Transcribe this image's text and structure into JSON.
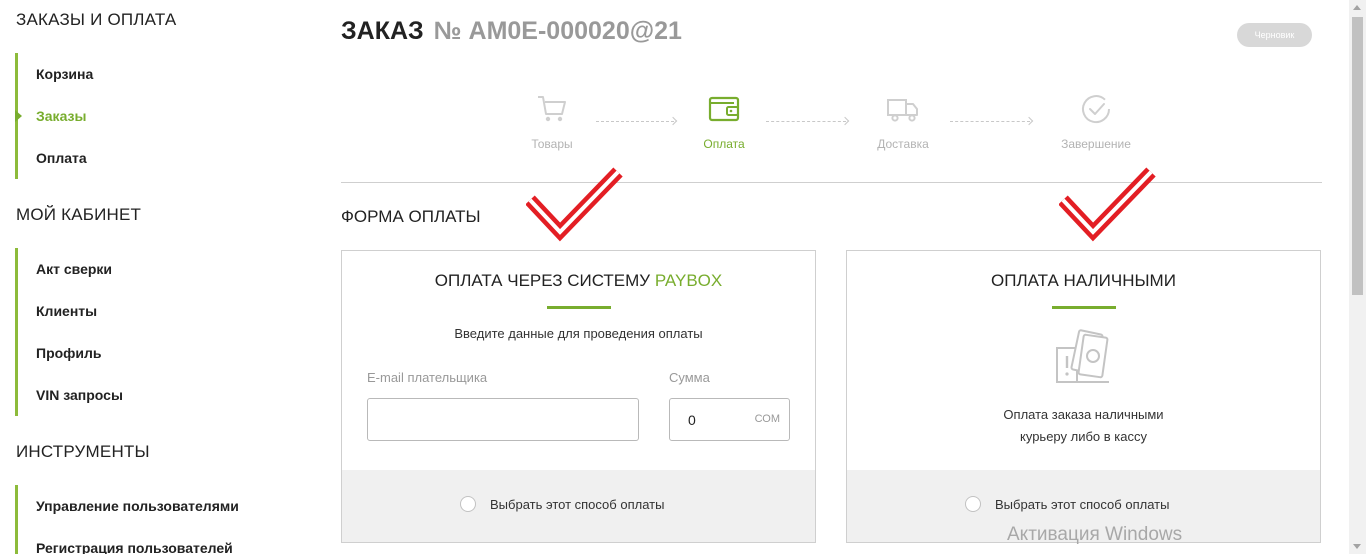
{
  "sidebar": {
    "sections": [
      {
        "title": "ЗАКАЗЫ И ОПЛАТА",
        "items": [
          {
            "label": "Корзина",
            "active": false
          },
          {
            "label": "Заказы",
            "active": true
          },
          {
            "label": "Оплата",
            "active": false
          }
        ]
      },
      {
        "title": "МОЙ КАБИНЕТ",
        "items": [
          {
            "label": "Акт сверки",
            "active": false
          },
          {
            "label": "Клиенты",
            "active": false
          },
          {
            "label": "Профиль",
            "active": false
          },
          {
            "label": "VIN запросы",
            "active": false
          }
        ]
      },
      {
        "title": "ИНСТРУМЕНТЫ",
        "items": [
          {
            "label": "Управление пользователями",
            "active": false
          },
          {
            "label": "Регистрация пользователей",
            "active": false
          }
        ]
      }
    ]
  },
  "order": {
    "title": "ЗАКАЗ",
    "number": "№ AM0E-000020@21",
    "status": "Черновик"
  },
  "steps": [
    {
      "label": "Товары",
      "icon": "cart-icon",
      "active": false
    },
    {
      "label": "Оплата",
      "icon": "wallet-icon",
      "active": true
    },
    {
      "label": "Доставка",
      "icon": "truck-icon",
      "active": false
    },
    {
      "label": "Завершение",
      "icon": "check-circle-icon",
      "active": false
    }
  ],
  "form": {
    "title": "ФОРМА ОПЛАТЫ",
    "paybox": {
      "title_prefix": "ОПЛАТА ЧЕРЕЗ СИСТЕМУ ",
      "title_highlight": "PAYBOX",
      "subtitle": "Введите данные для проведения оплаты",
      "email_label": "E-mail плательщика",
      "email_value": "",
      "sum_label": "Сумма",
      "sum_value": "0",
      "currency": "СОМ",
      "select_label": "Выбрать этот способ оплаты"
    },
    "cash": {
      "title": "ОПЛАТА НАЛИЧНЫМИ",
      "description_line1": "Оплата заказа наличными",
      "description_line2": "курьеру либо в кассу",
      "select_label": "Выбрать этот способ оплаты"
    }
  },
  "watermark": "Активация Windows",
  "colors": {
    "accent": "#78ad2e",
    "sidebar_line": "#8dbb3b",
    "check_mark": "#e31e24",
    "badge": "#d8d8d8"
  }
}
